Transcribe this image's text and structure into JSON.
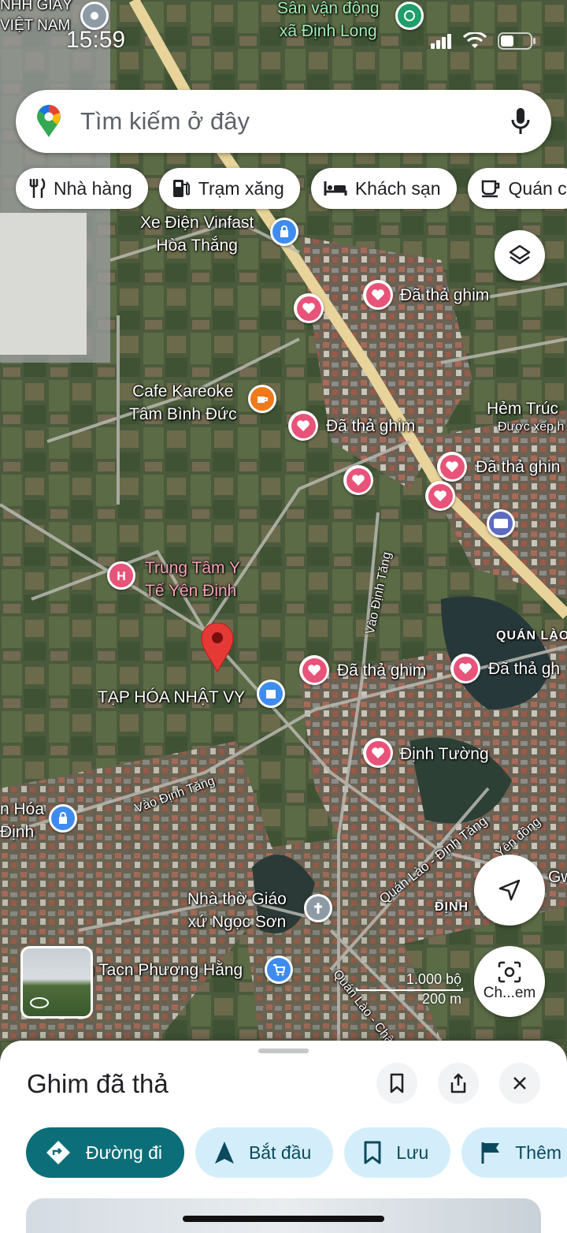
{
  "status_bar": {
    "time": "15:59"
  },
  "search": {
    "placeholder": "Tìm kiếm ở đây"
  },
  "chips": [
    {
      "label": "Nhà hàng",
      "icon": "restaurant-icon"
    },
    {
      "label": "Trạm xăng",
      "icon": "gas-station-icon"
    },
    {
      "label": "Khách sạn",
      "icon": "hotel-icon"
    },
    {
      "label": "Quán c",
      "icon": "cafe-icon"
    }
  ],
  "map": {
    "labels": {
      "top_left": "NHH GIẦY\nVIỆT NAM",
      "stadium": "Sân vận động\nxã Định Long",
      "vinfast": "Xe Điện Vinfast\nHòa Thắng",
      "pin1": "Đã thả ghim",
      "cafe": "Cafe Kareoke\nTâm Bình Đức",
      "pin2": "Đã thả ghim",
      "hem_truc": "Hẻm Trúc",
      "hem_truc_sub": "Được xếp h",
      "pin3": "Đã thả ghin",
      "hospital": "Trung Tâm Y\nTế Yên Định",
      "vao_dinh_tang_1": "Vào Định Tăng",
      "quan_lao": "QUÁN LÀO",
      "pin4": "Đã thả ghim",
      "pin5": "Đã thả gh",
      "store": "TẠP HÓA NHẬT VY",
      "dinh_tuong": "Định Tường",
      "vao_dinh_tang_2": "Vào Định Tăng",
      "hoa_dinh": "n Hóa\nĐịnh",
      "quan_lao_dinh_tang": "Quán Lào - Định Tăng",
      "yen_dong": "Yên đồng",
      "gwa": "Gwa",
      "dinh": "ĐỊNH",
      "church": "Nhà thờ Giáo\nxứ Ngọc Sơn",
      "tacn": "n Tacn Phương Hằng",
      "quan_lao_chau": "Quán Lào - Châu Bì"
    },
    "scale": {
      "imperial": "1.000 bộ",
      "metric": "200 m"
    }
  },
  "buttons": {
    "lens_label": "Ch...em"
  },
  "sheet": {
    "title": "Ghim đã thả",
    "actions": [
      {
        "label": "Đường đi",
        "icon": "directions-icon"
      },
      {
        "label": "Bắt đầu",
        "icon": "navigation-arrow-icon"
      },
      {
        "label": "Lưu",
        "icon": "bookmark-icon"
      },
      {
        "label": "Thêm",
        "icon": "flag-icon"
      }
    ]
  },
  "colors": {
    "pin_pink": "#e8537a",
    "primary_action": "#0b6e78",
    "action_bg": "#d3eefa",
    "road_yellow": "#e8d49a"
  }
}
